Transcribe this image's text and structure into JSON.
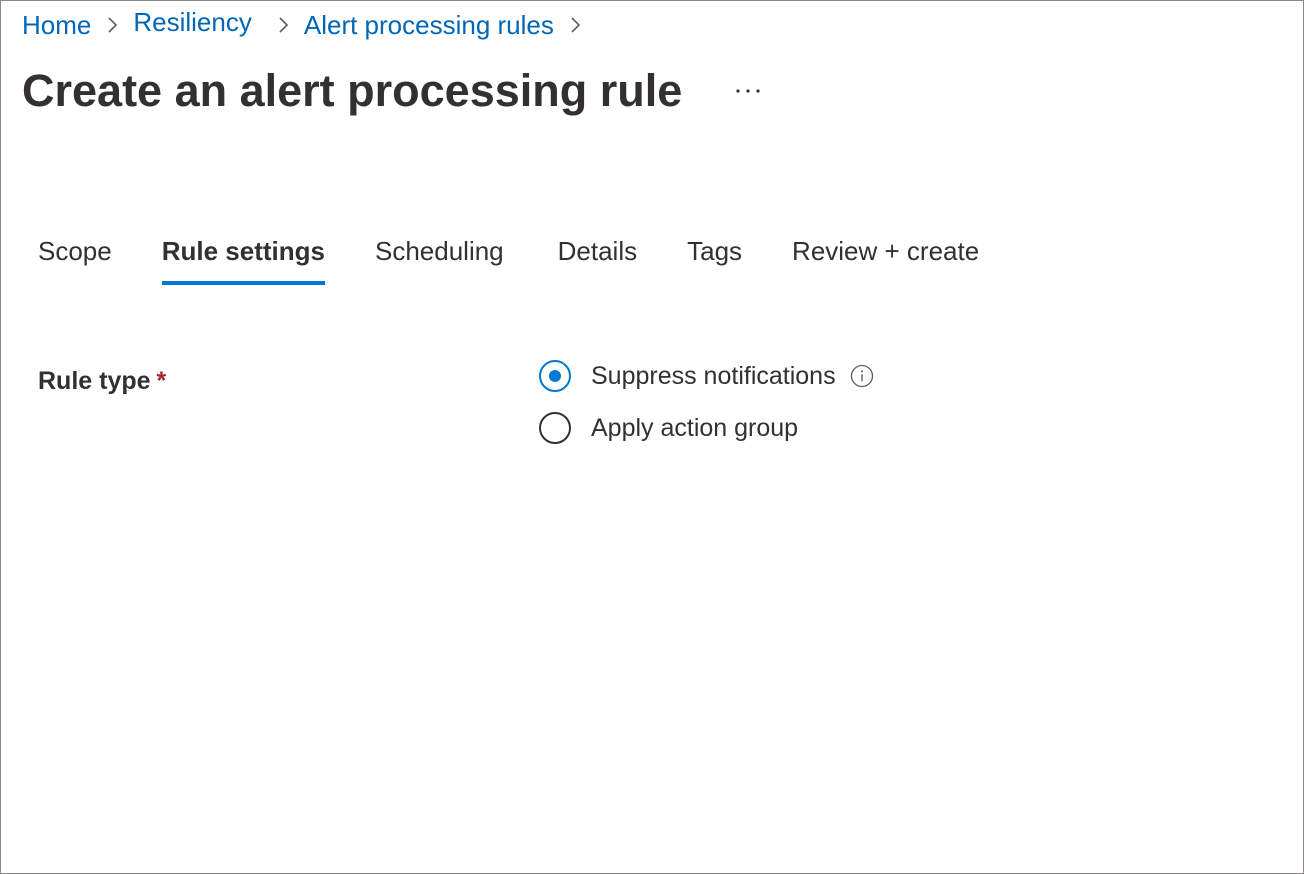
{
  "breadcrumb": {
    "items": [
      {
        "label": "Home"
      },
      {
        "label": "Resiliency"
      },
      {
        "label": "Alert processing rules"
      }
    ]
  },
  "page": {
    "title": "Create an alert processing rule",
    "more_icon": "ellipsis-icon"
  },
  "tabs": [
    {
      "label": "Scope",
      "active": false
    },
    {
      "label": "Rule settings",
      "active": true
    },
    {
      "label": "Scheduling",
      "active": false
    },
    {
      "label": "Details",
      "active": false
    },
    {
      "label": "Tags",
      "active": false
    },
    {
      "label": "Review + create",
      "active": false
    }
  ],
  "form": {
    "rule_type": {
      "label": "Rule type",
      "required_marker": "*",
      "options": [
        {
          "label": "Suppress notifications",
          "checked": true,
          "info_icon": "info-icon"
        },
        {
          "label": "Apply action group",
          "checked": false
        }
      ]
    }
  },
  "colors": {
    "link": "#0067b8",
    "accent": "#0078d4",
    "text": "#323130",
    "required": "#a4262c"
  }
}
